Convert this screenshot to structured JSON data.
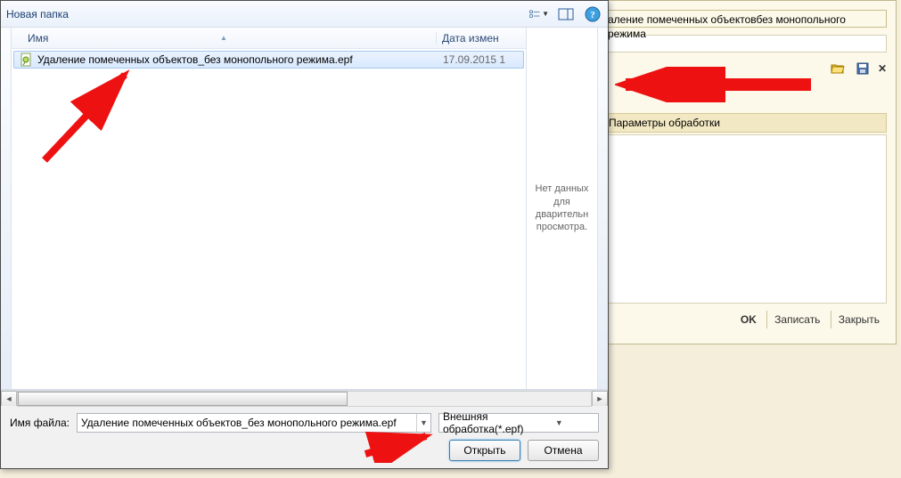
{
  "dialog": {
    "newFolder": "Новая папка",
    "columns": {
      "name": "Имя",
      "date": "Дата измен"
    },
    "file": {
      "name": "Удаление помеченных объектов_без монопольного режима.epf",
      "date": "17.09.2015 1"
    },
    "preview": "Нет данных для дварительн просмотра.",
    "filenameLabel": "Имя файла:",
    "filenameValue": "Удаление помеченных объектов_без монопольного режима.epf",
    "filter": "Внешняя обработка(*.epf)",
    "open": "Открыть",
    "cancel": "Отмена"
  },
  "bg": {
    "titleRight": "аление помеченных объектовбез монопольного режима",
    "sectionHeader": "Параметры обработки",
    "ok": "OK",
    "save": "Записать",
    "close": "Закрыть"
  }
}
